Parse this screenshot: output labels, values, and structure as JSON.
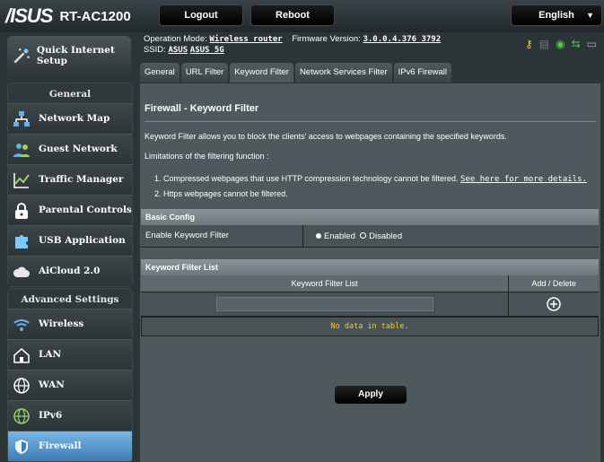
{
  "header": {
    "brand": "/ISUS",
    "model": "RT-AC1200",
    "logout": "Logout",
    "reboot": "Reboot",
    "language": "English"
  },
  "sidebar": {
    "quick_setup": "Quick Internet Setup",
    "general_title": "General",
    "general_items": [
      {
        "label": "Network Map"
      },
      {
        "label": "Guest Network"
      },
      {
        "label": "Traffic Manager"
      },
      {
        "label": "Parental Controls"
      },
      {
        "label": "USB Application"
      },
      {
        "label": "AiCloud 2.0"
      }
    ],
    "advanced_title": "Advanced Settings",
    "advanced_items": [
      {
        "label": "Wireless"
      },
      {
        "label": "LAN"
      },
      {
        "label": "WAN"
      },
      {
        "label": "IPv6"
      },
      {
        "label": "Firewall"
      }
    ]
  },
  "info": {
    "op_mode_label": "Operation Mode:",
    "op_mode_value": "Wireless router",
    "fw_label": "Firmware Version:",
    "fw_value": "3.0.0.4.376_3792",
    "ssid_label": "SSID:",
    "ssid1": "ASUS",
    "ssid2": "ASUS_5G"
  },
  "tabs": [
    {
      "label": "General"
    },
    {
      "label": "URL Filter"
    },
    {
      "label": "Keyword Filter"
    },
    {
      "label": "Network Services Filter"
    },
    {
      "label": "IPv6 Firewall"
    }
  ],
  "panel": {
    "title": "Firewall - Keyword Filter",
    "desc": "Keyword Filter allows you to block the clients' access to webpages containing the specified keywords.",
    "limits": "Limitations of the filtering function :",
    "item1": "1.  Compressed webpages that use HTTP compression technology cannot be filtered.",
    "item1_link": "See here for more details.",
    "item2": "2.  Https webpages cannot be filtered.",
    "basic_config": "Basic Config",
    "enable_label": "Enable Keyword Filter",
    "enabled": "Enabled",
    "disabled": "Disabled",
    "list_title": "Keyword Filter List",
    "col_list": "Keyword Filter List",
    "col_add": "Add / Delete",
    "no_data": "No data in table.",
    "apply": "Apply"
  },
  "colors": {
    "accent_active": "#5a9bd4",
    "panel_bg": "#4d595d",
    "no_data_text": "#ffcc00"
  }
}
